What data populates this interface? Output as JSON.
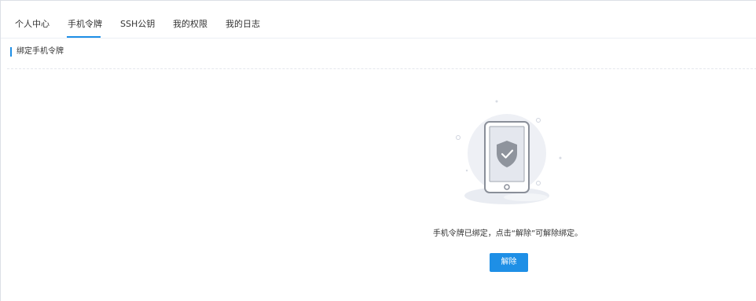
{
  "tabs": [
    {
      "label": "个人中心",
      "active": false
    },
    {
      "label": "手机令牌",
      "active": true
    },
    {
      "label": "SSH公钥",
      "active": false
    },
    {
      "label": "我的权限",
      "active": false
    },
    {
      "label": "我的日志",
      "active": false
    }
  ],
  "section": {
    "title": "绑定手机令牌"
  },
  "main": {
    "illustration_icon": "phone-shield-check-icon",
    "message": "手机令牌已绑定，点击“解除”可解除绑定。",
    "unbind_button_label": "解除"
  },
  "colors": {
    "accent": "#1e8fe6",
    "text": "#333333",
    "divider": "#ebeef5"
  }
}
